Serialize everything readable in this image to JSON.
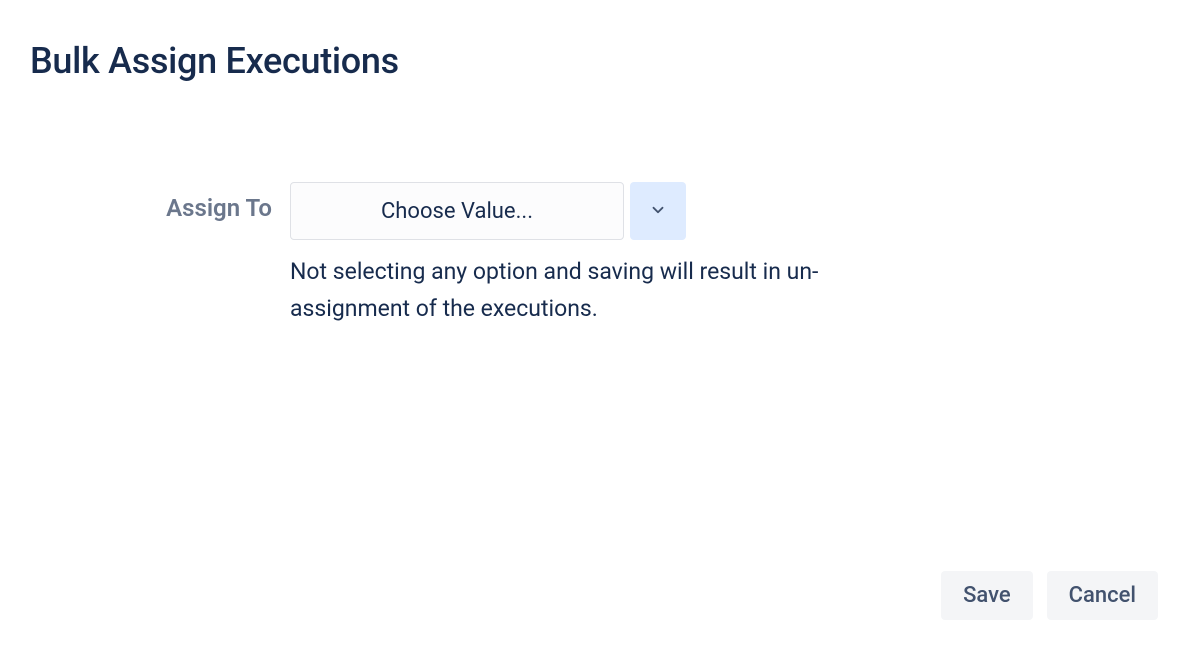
{
  "page": {
    "title": "Bulk Assign Executions"
  },
  "form": {
    "assign_to": {
      "label": "Assign To",
      "placeholder": "Choose Value...",
      "helper_text": "Not selecting any option and saving will result in un-assignment of the executions."
    }
  },
  "actions": {
    "save_label": "Save",
    "cancel_label": "Cancel"
  }
}
